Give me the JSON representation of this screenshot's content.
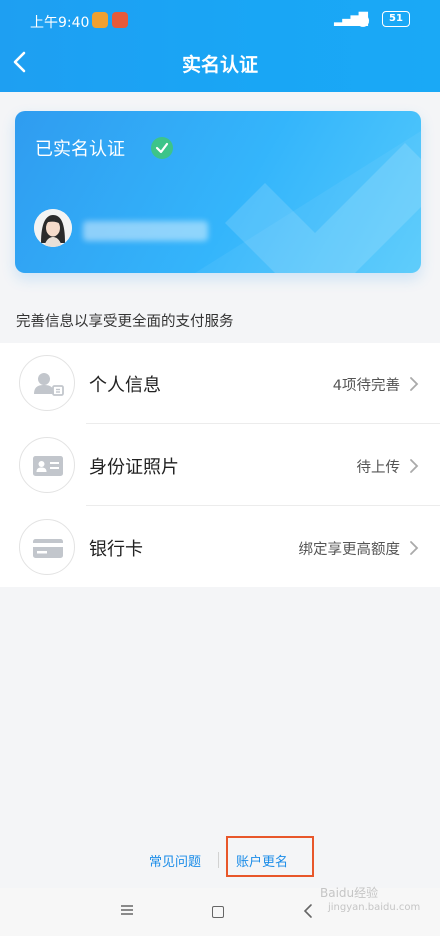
{
  "status_bar": {
    "time": "上午9:40",
    "battery": "51"
  },
  "header": {
    "title": "实名认证"
  },
  "card": {
    "title": "已实名认证"
  },
  "section": {
    "heading": "完善信息以享受更全面的支付服务"
  },
  "list": {
    "items": [
      {
        "label": "个人信息",
        "status": "4项待完善",
        "icon": "person-card-icon"
      },
      {
        "label": "身份证照片",
        "status": "待上传",
        "icon": "id-card-icon"
      },
      {
        "label": "银行卡",
        "status": "绑定享更高额度",
        "icon": "bank-card-icon"
      }
    ]
  },
  "footer": {
    "faq": "常见问题",
    "rename": "账户更名"
  },
  "watermark": {
    "text": "Baidu经验",
    "url": "jingyan.baidu.com"
  },
  "colors": {
    "primary": "#1e9ff2",
    "link": "#1a8ce8",
    "verified": "#3dc489",
    "highlight": "#e8572a"
  }
}
